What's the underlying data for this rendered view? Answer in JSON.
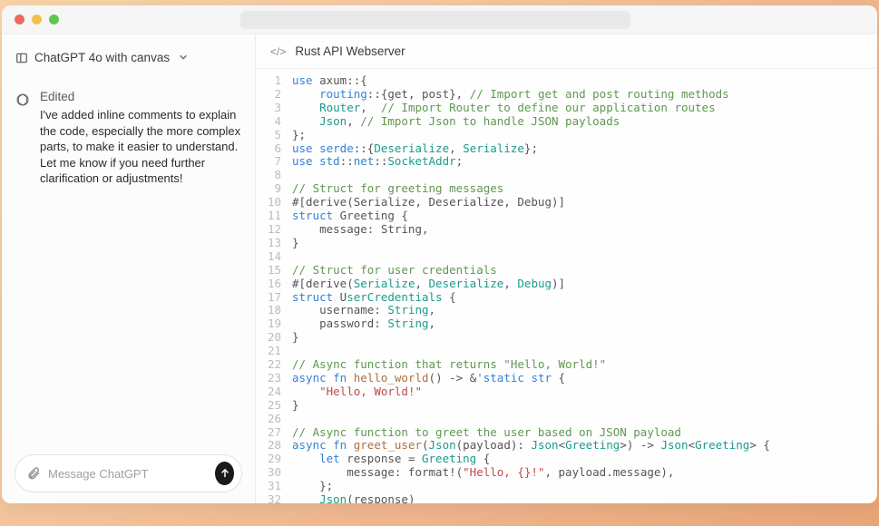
{
  "model": {
    "label": "ChatGPT 4o with canvas"
  },
  "conversation": {
    "status": "Edited",
    "message": "I've added inline comments to explain the code, especially the more complex parts, to make it easier to understand. Let me know if you need further clarification or adjustments!"
  },
  "composer": {
    "placeholder": "Message ChatGPT"
  },
  "canvas": {
    "title": "Rust API Webserver",
    "code_lines": [
      [
        {
          "t": "kw",
          "v": "use"
        },
        {
          "t": "plain",
          "v": " axum::{"
        }
      ],
      [
        {
          "t": "plain",
          "v": "    "
        },
        {
          "t": "path",
          "v": "routing"
        },
        {
          "t": "plain",
          "v": "::{get, post}, "
        },
        {
          "t": "comment",
          "v": "// Import get and post routing methods"
        }
      ],
      [
        {
          "t": "plain",
          "v": "    "
        },
        {
          "t": "type",
          "v": "Router"
        },
        {
          "t": "plain",
          "v": ",  "
        },
        {
          "t": "comment",
          "v": "// Import Router to define our application routes"
        }
      ],
      [
        {
          "t": "plain",
          "v": "    "
        },
        {
          "t": "type",
          "v": "Json"
        },
        {
          "t": "plain",
          "v": ", "
        },
        {
          "t": "comment",
          "v": "// Import Json to handle JSON payloads"
        }
      ],
      [
        {
          "t": "plain",
          "v": "};"
        }
      ],
      [
        {
          "t": "kw",
          "v": "use"
        },
        {
          "t": "plain",
          "v": " "
        },
        {
          "t": "path",
          "v": "serde"
        },
        {
          "t": "plain",
          "v": "::{"
        },
        {
          "t": "type",
          "v": "Deserialize"
        },
        {
          "t": "plain",
          "v": ", "
        },
        {
          "t": "type",
          "v": "Serialize"
        },
        {
          "t": "plain",
          "v": "};"
        }
      ],
      [
        {
          "t": "kw",
          "v": "use"
        },
        {
          "t": "plain",
          "v": " "
        },
        {
          "t": "path",
          "v": "std"
        },
        {
          "t": "plain",
          "v": "::"
        },
        {
          "t": "path",
          "v": "net"
        },
        {
          "t": "plain",
          "v": "::"
        },
        {
          "t": "type",
          "v": "SocketAddr"
        },
        {
          "t": "plain",
          "v": ";"
        }
      ],
      [],
      [
        {
          "t": "comment",
          "v": "// Struct for greeting messages"
        }
      ],
      [
        {
          "t": "attr",
          "v": "#[derive(Serialize, Deserialize, Debug)]"
        }
      ],
      [
        {
          "t": "kw",
          "v": "struct"
        },
        {
          "t": "plain",
          "v": " Greeting {"
        }
      ],
      [
        {
          "t": "plain",
          "v": "    message: String,"
        }
      ],
      [
        {
          "t": "plain",
          "v": "}"
        }
      ],
      [],
      [
        {
          "t": "comment",
          "v": "// Struct for user credentials"
        }
      ],
      [
        {
          "t": "attr",
          "v": "#[derive("
        },
        {
          "t": "type",
          "v": "Serialize"
        },
        {
          "t": "attr",
          "v": ", "
        },
        {
          "t": "type",
          "v": "Deserialize"
        },
        {
          "t": "attr",
          "v": ", "
        },
        {
          "t": "type",
          "v": "Debug"
        },
        {
          "t": "attr",
          "v": ")]"
        }
      ],
      [
        {
          "t": "kw",
          "v": "struct"
        },
        {
          "t": "plain",
          "v": " U"
        },
        {
          "t": "type",
          "v": "serCredentials"
        },
        {
          "t": "plain",
          "v": " {"
        }
      ],
      [
        {
          "t": "plain",
          "v": "    username: "
        },
        {
          "t": "type",
          "v": "String"
        },
        {
          "t": "plain",
          "v": ","
        }
      ],
      [
        {
          "t": "plain",
          "v": "    password: "
        },
        {
          "t": "type",
          "v": "String"
        },
        {
          "t": "plain",
          "v": ","
        }
      ],
      [
        {
          "t": "plain",
          "v": "}"
        }
      ],
      [],
      [
        {
          "t": "comment",
          "v": "// Async function that returns \"Hello, World!\""
        }
      ],
      [
        {
          "t": "kw",
          "v": "async fn"
        },
        {
          "t": "plain",
          "v": " "
        },
        {
          "t": "fn",
          "v": "hello_world"
        },
        {
          "t": "plain",
          "v": "() -> &"
        },
        {
          "t": "kw",
          "v": "'static str"
        },
        {
          "t": "plain",
          "v": " {"
        }
      ],
      [
        {
          "t": "plain",
          "v": "    "
        },
        {
          "t": "str",
          "v": "\"Hello, World!\""
        }
      ],
      [
        {
          "t": "plain",
          "v": "}"
        }
      ],
      [],
      [
        {
          "t": "comment",
          "v": "// Async function to greet the user based on JSON payload"
        }
      ],
      [
        {
          "t": "kw",
          "v": "async fn"
        },
        {
          "t": "plain",
          "v": " "
        },
        {
          "t": "fn",
          "v": "greet_user"
        },
        {
          "t": "plain",
          "v": "("
        },
        {
          "t": "type",
          "v": "Json"
        },
        {
          "t": "plain",
          "v": "(payload): "
        },
        {
          "t": "type",
          "v": "Json"
        },
        {
          "t": "plain",
          "v": "<"
        },
        {
          "t": "type",
          "v": "Greeting"
        },
        {
          "t": "plain",
          "v": ">) -> "
        },
        {
          "t": "type",
          "v": "Json"
        },
        {
          "t": "plain",
          "v": "<"
        },
        {
          "t": "type",
          "v": "Greeting"
        },
        {
          "t": "plain",
          "v": "> {"
        }
      ],
      [
        {
          "t": "plain",
          "v": "    "
        },
        {
          "t": "kw",
          "v": "let"
        },
        {
          "t": "plain",
          "v": " response = "
        },
        {
          "t": "type",
          "v": "Greeting"
        },
        {
          "t": "plain",
          "v": " {"
        }
      ],
      [
        {
          "t": "plain",
          "v": "        message: format!("
        },
        {
          "t": "str",
          "v": "\"Hello, {}!\""
        },
        {
          "t": "plain",
          "v": ", payload.message),"
        }
      ],
      [
        {
          "t": "plain",
          "v": "    };"
        }
      ],
      [
        {
          "t": "plain",
          "v": "    "
        },
        {
          "t": "type",
          "v": "Json"
        },
        {
          "t": "plain",
          "v": "(response)"
        }
      ]
    ]
  }
}
